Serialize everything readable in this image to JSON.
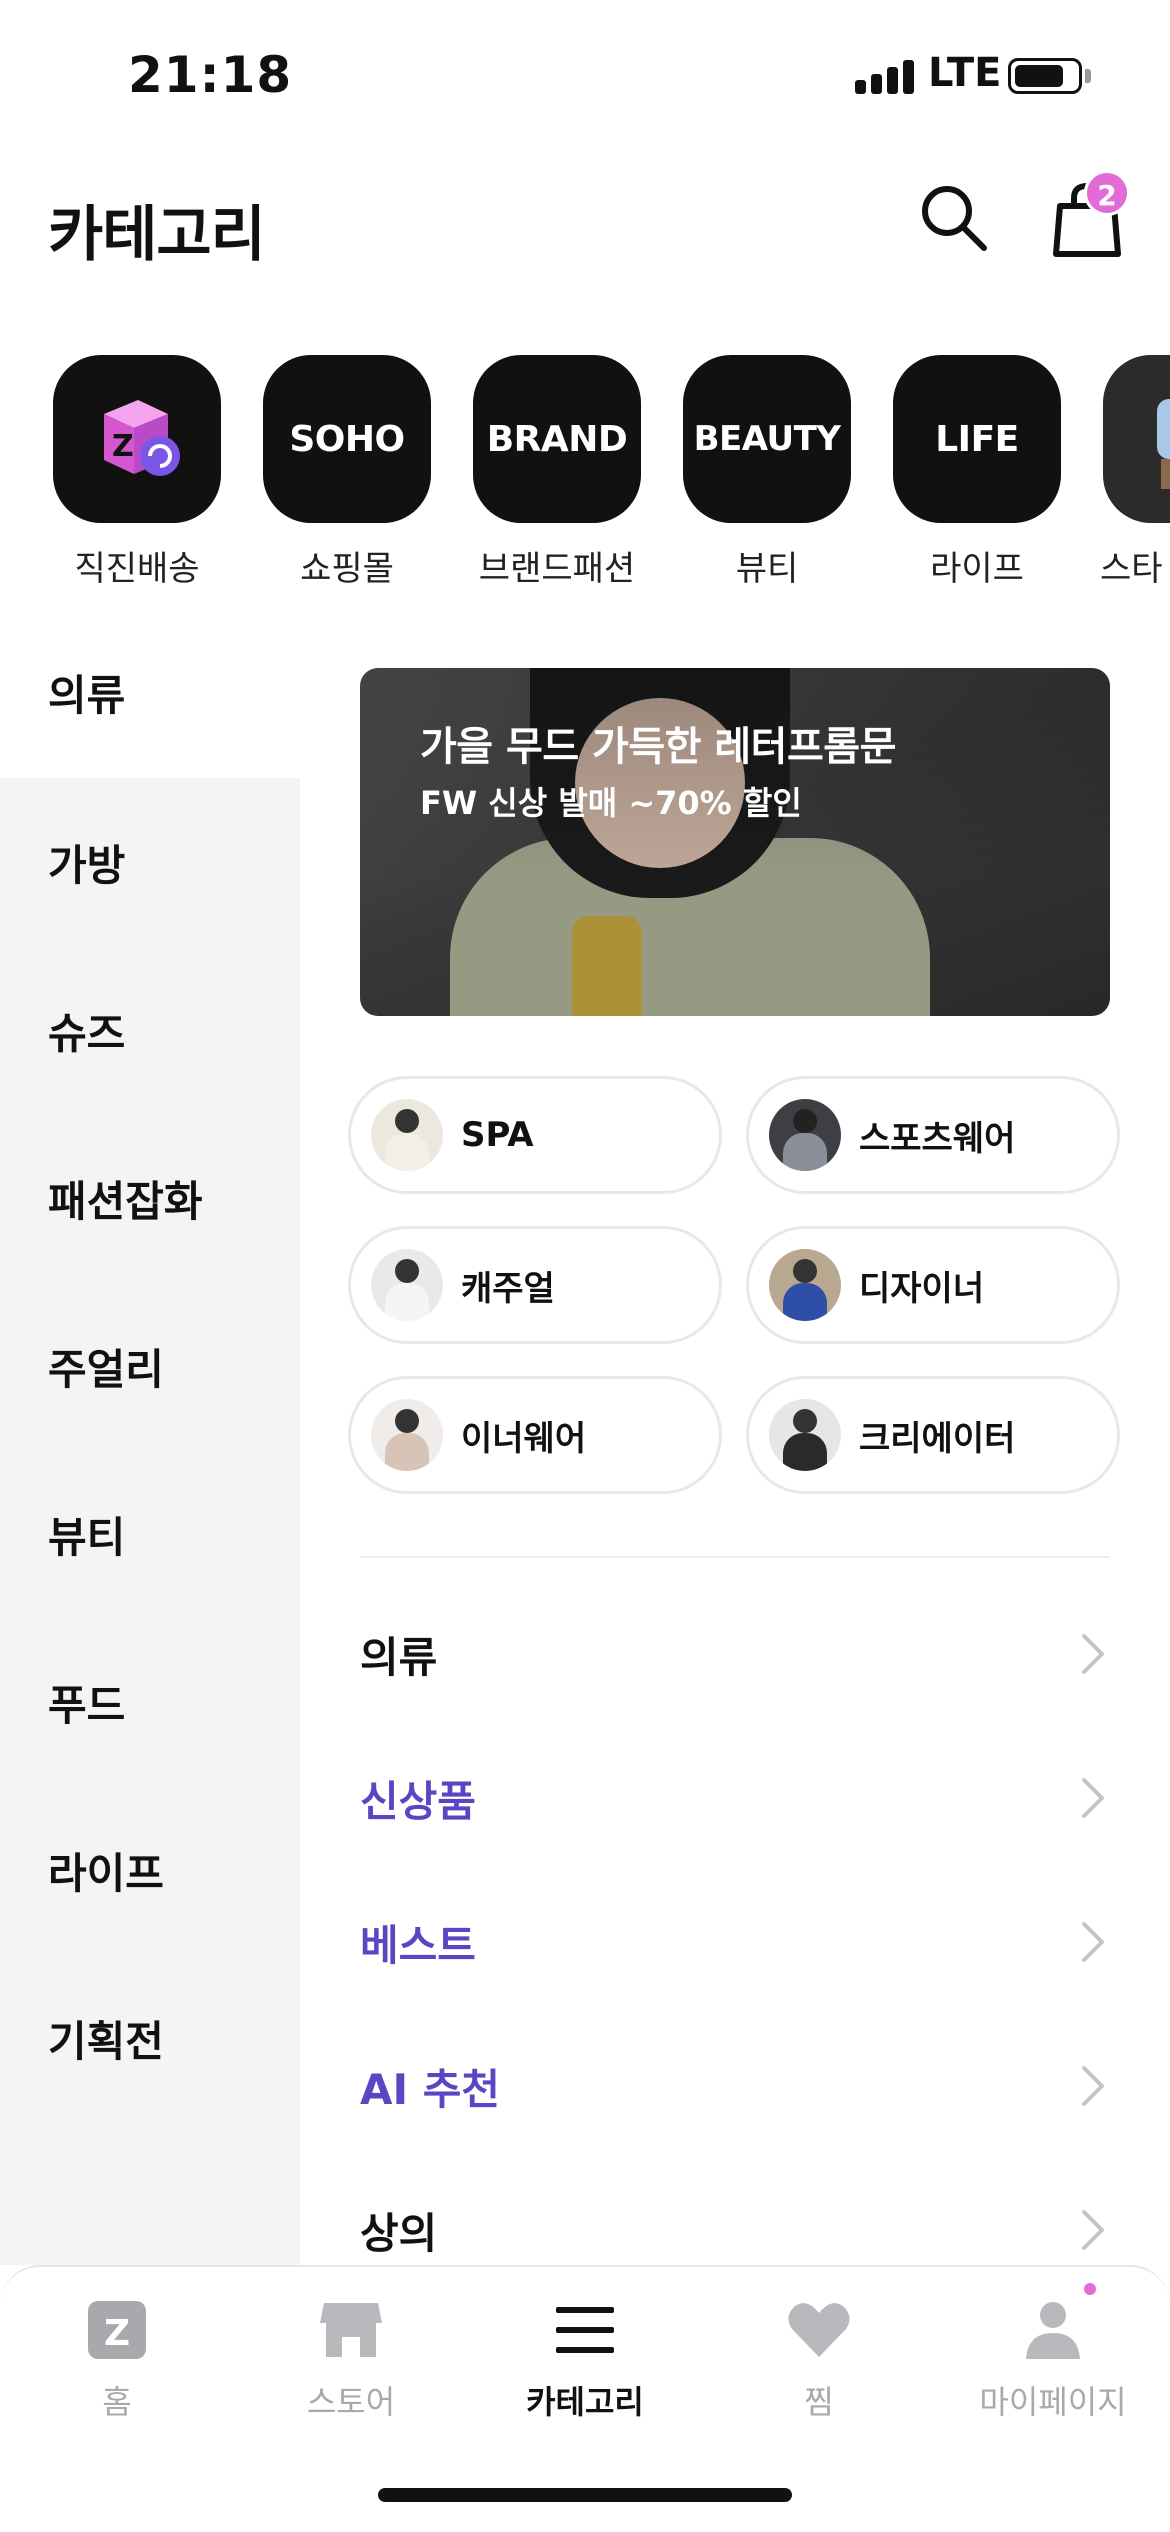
{
  "status_bar": {
    "time": "21:18",
    "network": "LTE"
  },
  "header": {
    "title": "카테고리",
    "cart_count": "2"
  },
  "shortcuts": [
    {
      "tile": "",
      "label": "직진배송",
      "icon": "zigzag-box-icon"
    },
    {
      "tile": "SOHO",
      "label": "쇼핑몰"
    },
    {
      "tile": "BRAND",
      "label": "브랜드패션"
    },
    {
      "tile": "BEAUTY",
      "label": "뷰티"
    },
    {
      "tile": "LIFE",
      "label": "라이프"
    },
    {
      "tile": "",
      "label": "스타"
    }
  ],
  "side_menu": {
    "items": [
      "의류",
      "가방",
      "슈즈",
      "패션잡화",
      "주얼리",
      "뷰티",
      "푸드",
      "라이프",
      "기획전"
    ],
    "active": "의류"
  },
  "banner": {
    "title": "가을 무드 가득한 레터프롬문",
    "subtitle": "FW 신상 발매 ~70% 할인"
  },
  "chips": [
    {
      "label": "SPA"
    },
    {
      "label": "스포츠웨어"
    },
    {
      "label": "캐주얼"
    },
    {
      "label": "디자이너"
    },
    {
      "label": "이너웨어"
    },
    {
      "label": "크리에이터"
    }
  ],
  "list": [
    {
      "label": "의류",
      "accent": false
    },
    {
      "label": "신상품",
      "accent": true
    },
    {
      "label": "베스트",
      "accent": true
    },
    {
      "label": "AI 추천",
      "accent": true
    },
    {
      "label": "상의",
      "accent": false
    }
  ],
  "tabbar": {
    "items": [
      {
        "label": "홈",
        "icon": "zigzag-home-icon"
      },
      {
        "label": "스토어",
        "icon": "store-icon"
      },
      {
        "label": "카테고리",
        "icon": "menu-icon"
      },
      {
        "label": "찜",
        "icon": "heart-icon"
      },
      {
        "label": "마이페이지",
        "icon": "person-icon"
      }
    ],
    "active": "카테고리"
  },
  "colors": {
    "accent": "#5b45c2",
    "badge": "#e36bd7",
    "side_bg": "#f3f4f6"
  }
}
